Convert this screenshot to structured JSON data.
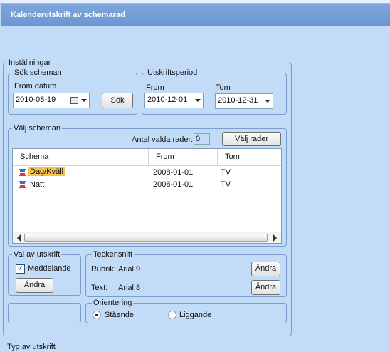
{
  "window": {
    "title": "Kalenderutskrift av schemarad"
  },
  "settings": {
    "legend": "Inställningar",
    "search": {
      "legend": "Sök scheman",
      "from_label": "From datum",
      "from_value": "2010-08-19",
      "button": "Sök"
    },
    "period": {
      "legend": "Utskriftsperiod",
      "from_label": "From",
      "from_value": "2010-12-01",
      "to_label": "Tom",
      "to_value": "2010-12-31"
    },
    "schedules": {
      "legend": "Välj scheman",
      "count_label": "Antal valda rader:",
      "count_value": "0",
      "select_button": "Välj rader",
      "columns": [
        "Schema",
        "From",
        "Tom"
      ],
      "rows": [
        {
          "schema": "Dag/Kväll",
          "from": "2008-01-01",
          "tom": "TV",
          "selected": true
        },
        {
          "schema": "Natt",
          "from": "2008-01-01",
          "tom": "TV",
          "selected": false
        }
      ]
    },
    "print_choice": {
      "legend": "Val av utskrift",
      "checkbox_label": "Meddelande",
      "checkbox_checked": true,
      "change_button": "Ändra"
    },
    "font": {
      "legend": "Teckensnitt",
      "heading_label": "Rubrik:",
      "heading_value": "Arial 9",
      "text_label": "Text:",
      "text_value": "Arial 8",
      "change_button": "Ändra"
    },
    "orientation": {
      "legend": "Orientering",
      "options": [
        "Stående",
        "Liggande"
      ],
      "selected": "Stående"
    }
  },
  "bottom_label": "Typ av utskrift"
}
